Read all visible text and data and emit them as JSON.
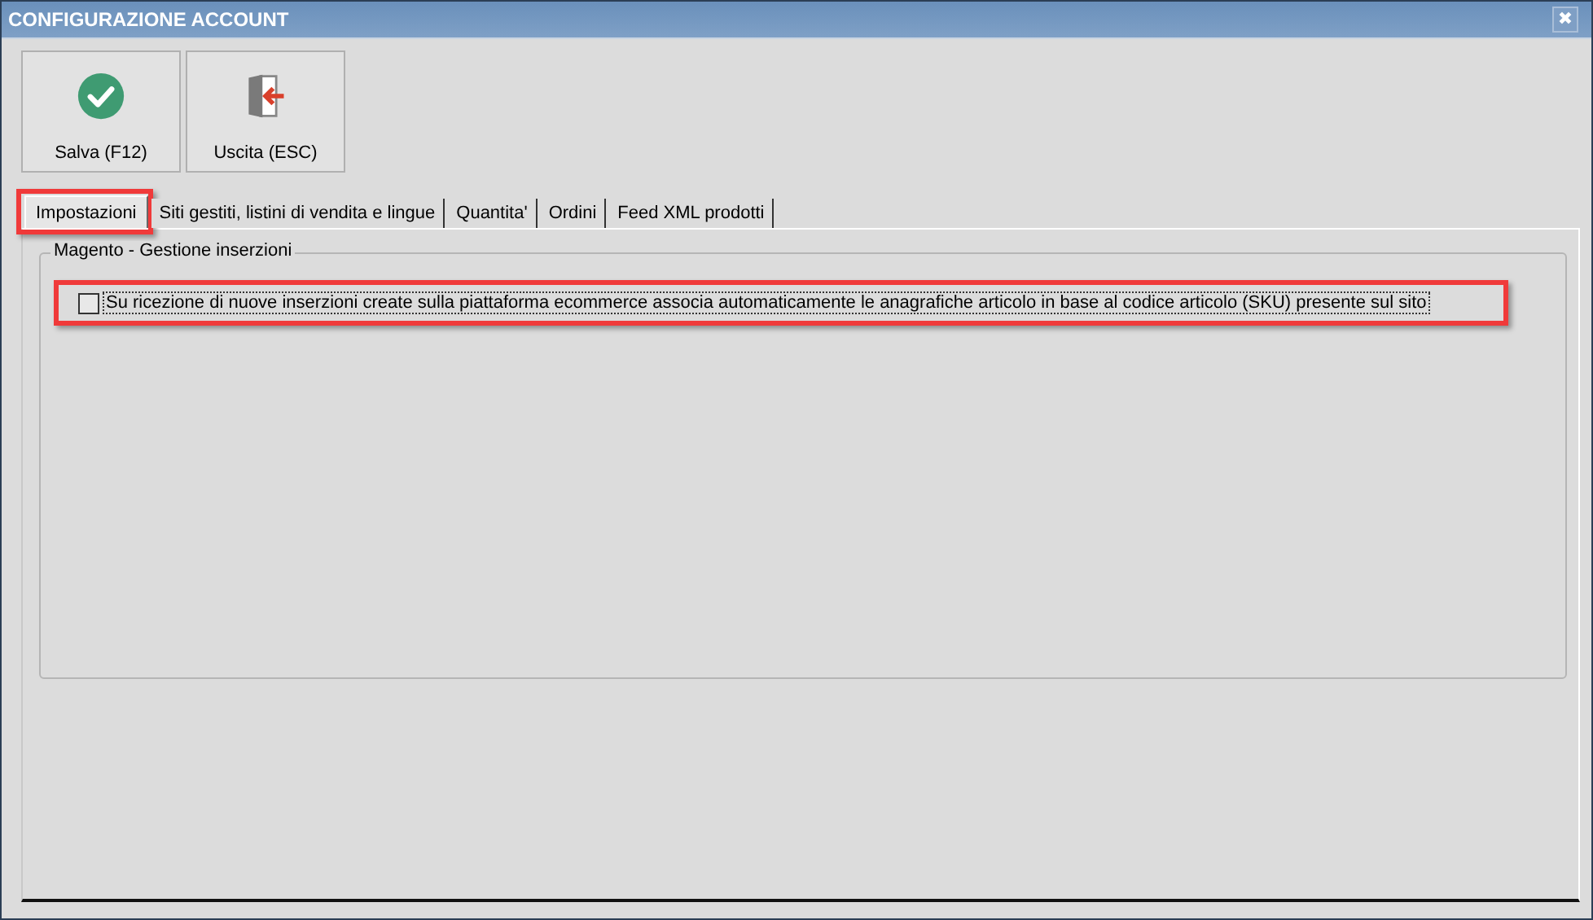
{
  "window": {
    "title": "CONFIGURAZIONE ACCOUNT",
    "close": "✖"
  },
  "toolbar": [
    {
      "kind": "save",
      "label": "Salva (F12)"
    },
    {
      "kind": "exit",
      "label": "Uscita (ESC)"
    }
  ],
  "tabs": [
    {
      "label": "Impostazioni",
      "selected": true,
      "highlighted": true
    },
    {
      "label": "Siti gestiti, listini di vendita e lingue",
      "selected": false,
      "highlighted": false
    },
    {
      "label": "Quantita'",
      "selected": false,
      "highlighted": false
    },
    {
      "label": "Ordini",
      "selected": false,
      "highlighted": false
    },
    {
      "label": "Feed XML prodotti",
      "selected": false,
      "highlighted": false
    }
  ],
  "group": {
    "title": "Magento - Gestione inserzioni",
    "options": [
      {
        "label": "Su ricezione di nuove inserzioni create sulla piattaforma ecommerce associa automaticamente le anagrafiche articolo in base al codice articolo (SKU) presente sul sito",
        "checked": false,
        "highlighted": true
      }
    ]
  }
}
